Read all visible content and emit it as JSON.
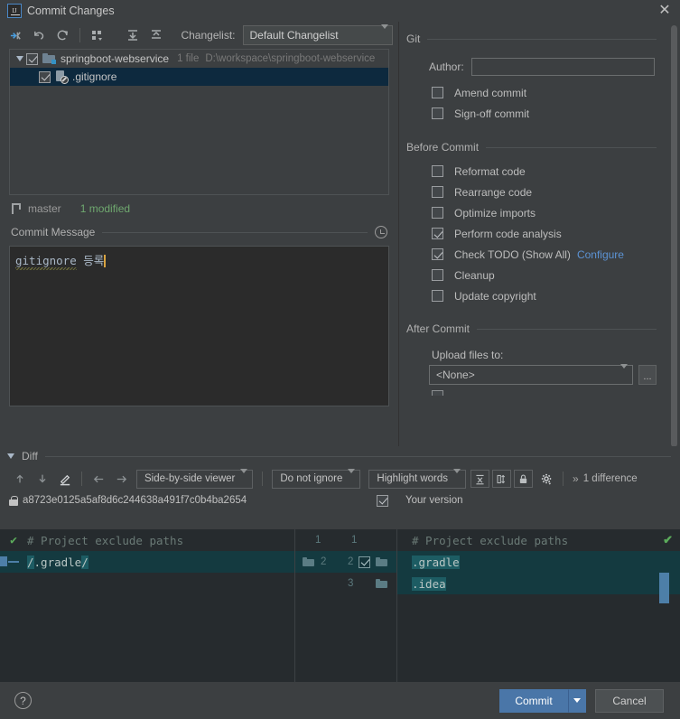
{
  "window": {
    "title": "Commit Changes",
    "app_icon": "intellij-idea-icon",
    "close_icon": "close-icon"
  },
  "toolbar": {
    "icons": [
      {
        "name": "show-diff-icon",
        "title": "Show Diff"
      },
      {
        "name": "revert-icon",
        "title": "Revert"
      },
      {
        "name": "refresh-icon",
        "title": "Refresh"
      },
      {
        "name": "group-by-icon",
        "title": "Group By"
      },
      {
        "name": "expand-all-icon",
        "title": "Expand All"
      },
      {
        "name": "collapse-all-icon",
        "title": "Collapse All"
      }
    ],
    "changelist_label": "Changelist:",
    "changelist_value": "Default Changelist"
  },
  "tree": {
    "root": {
      "name": "springboot-webservice",
      "meta": "1 file",
      "path": "D:\\workspace\\springboot-webservice",
      "checked": true,
      "expanded": true
    },
    "children": [
      {
        "name": ".gitignore",
        "checked": true,
        "selected": true,
        "icon": "ignored-file-icon"
      }
    ]
  },
  "status": {
    "branch_icon": "git-branch-icon",
    "branch": "master",
    "modified": "1 modified"
  },
  "commit_message": {
    "section_title": "Commit Message",
    "history_icon": "history-clock-icon",
    "misspelled_word": "gitignore",
    "rest": " 등록",
    "full_text": "gitignore 등록"
  },
  "options": {
    "groups": [
      {
        "title": "Git",
        "author_label": "Author:",
        "author_value": "",
        "author_placeholder": "",
        "checkboxes": [
          {
            "label": "Amend commit",
            "checked": false
          },
          {
            "label": "Sign-off commit",
            "checked": false
          }
        ]
      },
      {
        "title": "Before Commit",
        "checkboxes": [
          {
            "label": "Reformat code",
            "checked": false
          },
          {
            "label": "Rearrange code",
            "checked": false
          },
          {
            "label": "Optimize imports",
            "checked": false
          },
          {
            "label": "Perform code analysis",
            "checked": true
          },
          {
            "label": "Check TODO (Show All)",
            "checked": true,
            "link": "Configure"
          },
          {
            "label": "Cleanup",
            "checked": false
          },
          {
            "label": "Update copyright",
            "checked": false
          }
        ]
      },
      {
        "title": "After Commit",
        "upload_label": "Upload files to:",
        "upload_value": "<None>",
        "ellipsis_label": "..."
      }
    ]
  },
  "diff": {
    "section_title": "Diff",
    "nav_icons": [
      {
        "name": "previous-difference-icon"
      },
      {
        "name": "next-difference-icon"
      },
      {
        "name": "edit-source-icon"
      },
      {
        "name": "apply-left-icon"
      },
      {
        "name": "apply-right-icon"
      }
    ],
    "viewer_mode": "Side-by-side viewer",
    "ignore_policy": "Do not ignore",
    "highlight_policy": "Highlight words",
    "toggle_icons": [
      {
        "name": "collapse-unchanged-fragments-icon"
      },
      {
        "name": "synchronize-scrolling-icon"
      },
      {
        "name": "read-only-lock-icon"
      },
      {
        "name": "diff-settings-gear-icon"
      }
    ],
    "more_icon": "chevron-double-right-icon",
    "difference_count": "1 difference",
    "left_title": {
      "lock_icon": "lock-icon",
      "text": "a8723e0125a5af8d6c244638a491f7c0b4ba2654"
    },
    "right_title": "Your version",
    "left_lines": [
      {
        "number": 1,
        "text": "# Project exclude paths",
        "type": "comment",
        "changed": false
      },
      {
        "number": 2,
        "text": "/.gradle/",
        "type": "code",
        "changed": true,
        "highlight_prefix": "/",
        "highlight_suffix": "/"
      }
    ],
    "right_lines": [
      {
        "number": 1,
        "text": "# Project exclude paths",
        "type": "comment",
        "changed": false
      },
      {
        "number": 2,
        "text": ".gradle",
        "type": "code",
        "changed": true
      },
      {
        "number": 3,
        "text": ".idea",
        "type": "code",
        "changed": true
      }
    ]
  },
  "footer": {
    "help_icon": "help-question-icon",
    "commit_label": "Commit",
    "commit_dropdown_icon": "chevron-down-icon",
    "cancel_label": "Cancel"
  },
  "colors": {
    "accent_blue": "#4a76a8",
    "link_blue": "#5c93d4",
    "changed_bg": "#143a40",
    "highlight_bg": "#1d5c63",
    "ok_green": "#5bab5b",
    "selection_blue": "#0d293e",
    "panel_bg": "#3c3f41",
    "editor_bg": "#262b2e"
  }
}
